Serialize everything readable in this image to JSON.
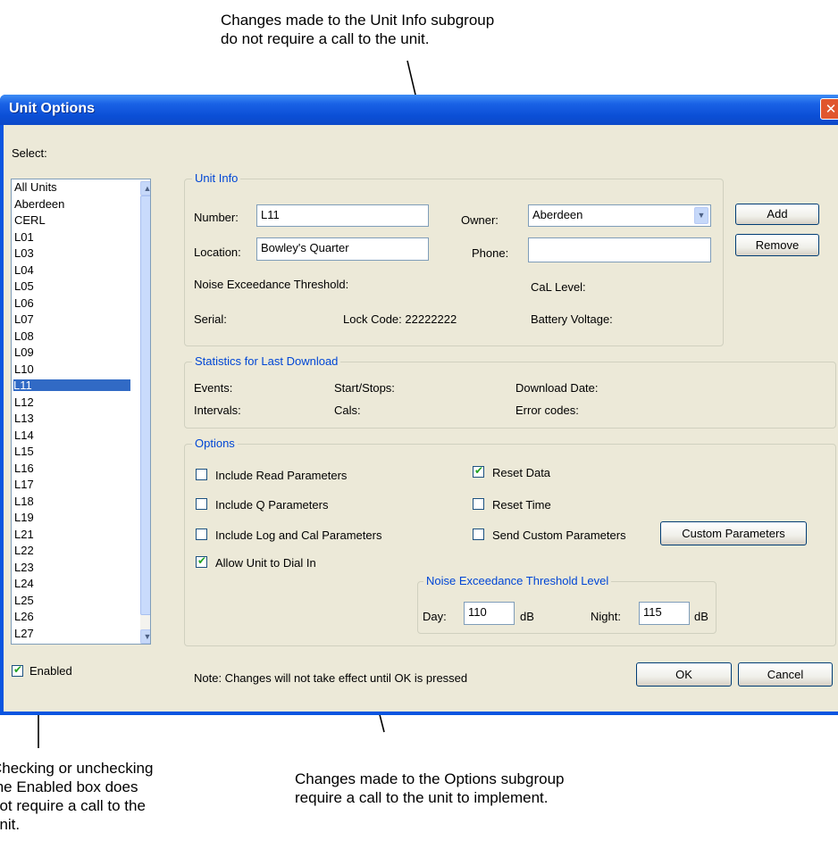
{
  "annotations": {
    "top": [
      "Changes made to the Unit Info subgroup",
      "do not require a call to the unit."
    ],
    "bottom_left": [
      "Checking or unchecking",
      "the Enabled box does",
      "not require a call to the",
      "unit."
    ],
    "bottom_right": [
      "Changes made to the Options subgroup",
      "require a call to the unit to implement."
    ]
  },
  "dialog": {
    "title": "Unit Options",
    "close_glyph": "✕",
    "select_label": "Select:",
    "units": [
      "All Units",
      "Aberdeen",
      "CERL",
      "L01",
      "L03",
      "L04",
      "L05",
      "L06",
      "L07",
      "L08",
      "L09",
      "L10",
      "L11",
      "L12",
      "L13",
      "L14",
      "L15",
      "L16",
      "L17",
      "L18",
      "L19",
      "L21",
      "L22",
      "L23",
      "L24",
      "L25",
      "L26",
      "L27"
    ],
    "selected_unit": "L11",
    "enabled_label": "Enabled",
    "enabled_checked": true,
    "unit_info": {
      "title": "Unit Info",
      "number_label": "Number:",
      "number_value": "L11",
      "owner_label": "Owner:",
      "owner_value": "Aberdeen",
      "location_label": "Location:",
      "location_value": "Bowley's Quarter",
      "phone_label": "Phone:",
      "phone_value": "",
      "noise_threshold_label": "Noise Exceedance Threshold:",
      "cal_level_label": "CaL Level:",
      "serial_label": "Serial:",
      "lock_code_label": "Lock Code: 22222222",
      "battery_label": "Battery Voltage:"
    },
    "statistics": {
      "title": "Statistics for Last Download",
      "events_label": "Events:",
      "start_stops_label": "Start/Stops:",
      "download_date_label": "Download Date:",
      "intervals_label": "Intervals:",
      "cals_label": "Cals:",
      "error_codes_label": "Error codes:"
    },
    "options": {
      "title": "Options",
      "include_read": {
        "label": "Include Read Parameters",
        "checked": false
      },
      "include_q": {
        "label": "Include Q Parameters",
        "checked": false
      },
      "include_log_cal": {
        "label": "Include Log and Cal Parameters",
        "checked": false
      },
      "allow_dial_in": {
        "label": "Allow Unit to Dial In",
        "checked": true
      },
      "reset_data": {
        "label": "Reset Data",
        "checked": true
      },
      "reset_time": {
        "label": "Reset Time",
        "checked": false
      },
      "send_custom": {
        "label": "Send Custom Parameters",
        "checked": false
      },
      "custom_params_button": "Custom Parameters",
      "threshold_group": {
        "title": "Noise Exceedance Threshold Level",
        "day_label": "Day:",
        "day_value": "110",
        "night_label": "Night:",
        "night_value": "115",
        "unit": "dB"
      }
    },
    "buttons": {
      "add": "Add",
      "remove": "Remove",
      "ok": "OK",
      "cancel": "Cancel"
    },
    "note": "Note: Changes will not take effect until OK is pressed",
    "check_glyph": "✔"
  }
}
